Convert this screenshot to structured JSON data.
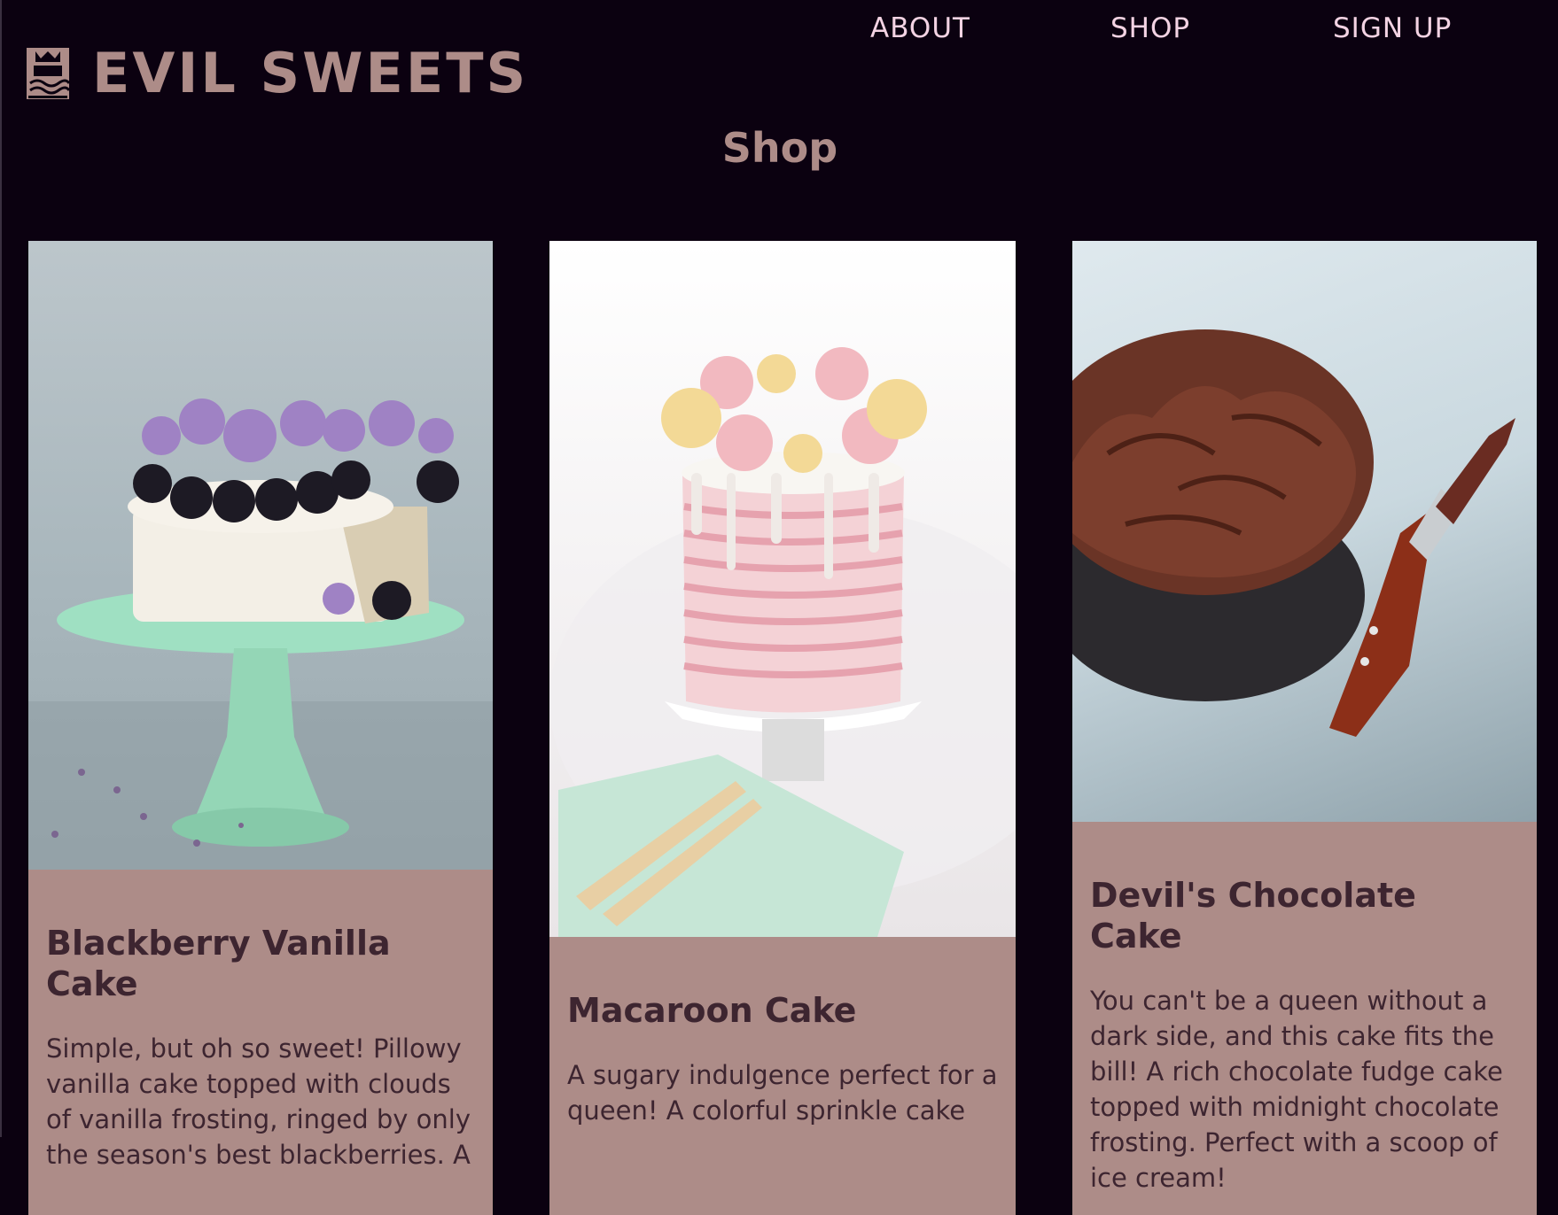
{
  "brand": {
    "name": "EVIL SWEETS",
    "logo_icon": "cake-crown-icon",
    "color": "#ad8c88"
  },
  "nav": {
    "items": [
      {
        "label": "ABOUT"
      },
      {
        "label": "SHOP"
      },
      {
        "label": "SIGN UP"
      }
    ],
    "color": "#f3d3e3"
  },
  "page": {
    "title": "Shop",
    "background": "#0b0110"
  },
  "products": [
    {
      "title": "Blackberry Vanilla Cake",
      "description": "Simple, but oh so sweet! Pillowy vanilla cake topped with clouds of vanilla frosting, ringed by only the season's best blackberries. A",
      "image": "blackberry-vanilla-cake-photo"
    },
    {
      "title": "Macaroon Cake",
      "description": "A sugary indulgence perfect for a queen! A colorful sprinkle cake",
      "image": "macaroon-cake-photo"
    },
    {
      "title": "Devil's Chocolate Cake",
      "description": "You can't be a queen without a dark side, and this cake fits the bill! A rich chocolate fudge cake topped with midnight chocolate frosting. Perfect with a scoop of ice cream!",
      "image": "devils-chocolate-cake-photo"
    }
  ],
  "card_color": "#ad8c88",
  "card_text_color": "#3d2530"
}
